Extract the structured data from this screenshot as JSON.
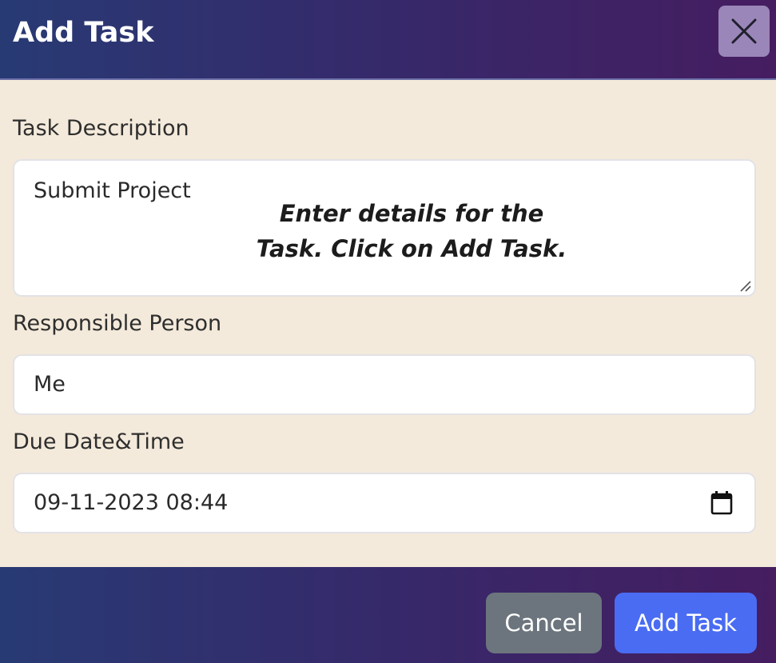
{
  "header": {
    "title": "Add Task",
    "close_icon": "close-icon"
  },
  "form": {
    "description": {
      "label": "Task Description",
      "value": "Submit Project"
    },
    "hint": {
      "line1": "Enter details for the",
      "line2": "Task. Click on Add Task."
    },
    "person": {
      "label": "Responsible Person",
      "value": "Me"
    },
    "due": {
      "label": "Due Date&Time",
      "value": "09-11-2023 08:44",
      "icon": "calendar-icon"
    }
  },
  "footer": {
    "cancel_label": "Cancel",
    "add_label": "Add Task"
  },
  "colors": {
    "header_gradient_start": "#283a74",
    "header_gradient_end": "#451d60",
    "body_bg": "#f4eadb",
    "cancel_bg": "#6c757d",
    "primary": "#4a6cf3"
  }
}
